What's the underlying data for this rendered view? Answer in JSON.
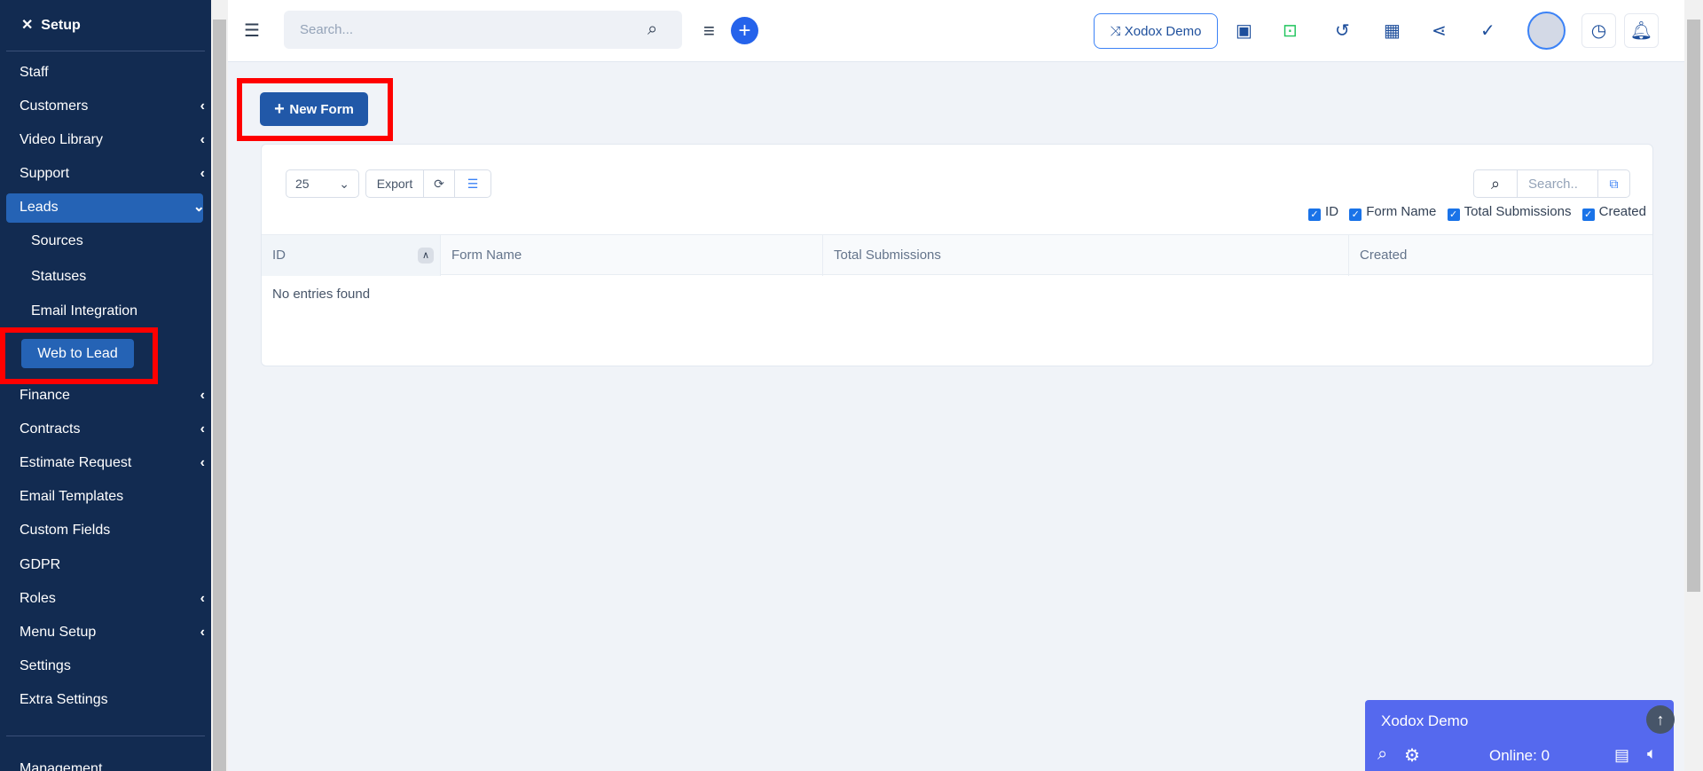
{
  "sidebar": {
    "title": "Setup",
    "items": [
      {
        "label": "Staff",
        "chevron": false
      },
      {
        "label": "Customers",
        "chevron": true
      },
      {
        "label": "Video Library",
        "chevron": true
      },
      {
        "label": "Support",
        "chevron": true
      },
      {
        "label": "Leads",
        "chevron": true,
        "active": true
      },
      {
        "label": "Sources",
        "sub": true
      },
      {
        "label": "Statuses",
        "sub": true
      },
      {
        "label": "Email Integration",
        "sub": true
      },
      {
        "label": "Web to Lead",
        "sub": true,
        "selected": true
      },
      {
        "label": "Finance",
        "chevron": true
      },
      {
        "label": "Contracts",
        "chevron": true
      },
      {
        "label": "Estimate Request",
        "chevron": true
      },
      {
        "label": "Email Templates",
        "chevron": false
      },
      {
        "label": "Custom Fields",
        "chevron": false
      },
      {
        "label": "GDPR",
        "chevron": false
      },
      {
        "label": "Roles",
        "chevron": true
      },
      {
        "label": "Menu Setup",
        "chevron": true
      },
      {
        "label": "Settings",
        "chevron": false
      },
      {
        "label": "Extra Settings",
        "chevron": false
      },
      {
        "label": "Management",
        "chevron": false
      }
    ]
  },
  "topbar": {
    "search_placeholder": "Search...",
    "company_button": "Xodox Demo"
  },
  "main": {
    "new_form_label": "New Form",
    "page_size": "25",
    "export_label": "Export",
    "search_placeholder": "Search..",
    "column_toggles": [
      "ID",
      "Form Name",
      "Total Submissions",
      "Created"
    ],
    "columns": [
      "ID",
      "Form Name",
      "Total Submissions",
      "Created"
    ],
    "empty_text": "No entries found"
  },
  "chat": {
    "title": "Xodox Demo",
    "online": "Online: 0"
  },
  "colors": {
    "sidebar": "#122b51",
    "accent": "#2563b5",
    "highlight": "#ff0000",
    "chat": "#5569ee"
  }
}
